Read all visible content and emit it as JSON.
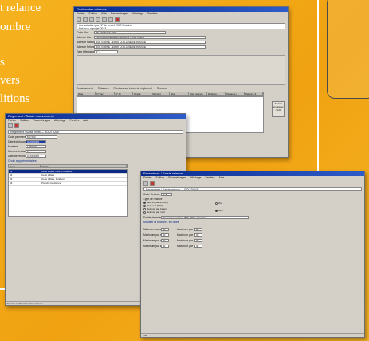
{
  "left_text": [
    "t relance",
    "ombre",
    "s",
    "vers",
    "litions"
  ],
  "win1": {
    "title": "Gestion des relances",
    "menu": [
      "Fichier",
      "Edition",
      "Aide",
      "Paramétrages",
      "Affichage",
      "Fenêtre",
      "Aide"
    ],
    "header_line1": "Consultation par N° de projet 2007 Antoine",
    "header_line2": "Relance n projet 0013",
    "fields": [
      {
        "label": "Code Bloc",
        "value": "R5 · FRANCE 2007"
      },
      {
        "label": "Adresse Livr.",
        "value": "PROGRAMME DE LA MAISON 75000 PARIS"
      },
      {
        "label": "Adresse Factur.",
        "value": "RUE CORNE - 92600 LA PLAINE DE FRANCE"
      },
      {
        "label": "Adresse Relance",
        "value": "RUE CORNE - 92600 LA PLAINE DE FRANCE"
      },
      {
        "label": "Type Affectation",
        "value": "N° 1"
      }
    ],
    "grid_headers": [
      "Date",
      "N° fac",
      "N° bn",
      "Libellé",
      "Montant",
      "Etat",
      "Date relance",
      "Relance 1",
      "Relance 2",
      "Relance 3"
    ],
    "tabs": [
      "Encaissement",
      "Relances",
      "Remises sur traites de règlement",
      "Recouvr."
    ],
    "side_button": "Sortir / Encaisser / Edit"
  },
  "win2": {
    "title": "Règlement / Saisie mouvements",
    "menu": [
      "Fichier",
      "Edition",
      "Paramétrages",
      "Affichage",
      "Fenêtre",
      "Aide"
    ],
    "header": "Réglement / Saisie mvts — BOUTIQUE",
    "fields": [
      {
        "label": "Code paiement",
        "value": "MR 000"
      },
      {
        "label": "Date échéance",
        "value": "01/01/2005"
      },
      {
        "label": "Montant",
        "value": "1 250,00"
      },
      {
        "label": "Nombre à saisir",
        "value": "1"
      },
      {
        "label": "Date de relance",
        "value": "01/01/2005"
      }
    ],
    "section": "Choix supplémentaires",
    "grid_headers": [
      "Code",
      "Libellé"
    ],
    "grid_rows": [
      [
        "01",
        "Cette affaire mise en relance"
      ],
      [
        "02",
        "Cette affaire"
      ],
      [
        "03",
        "Cette affaire, livraison"
      ],
      [
        "04",
        "Prendre la relance"
      ]
    ],
    "status": "Saisie / confirmation des relances"
  },
  "win3": {
    "title": "Paramètres / Saisie relance",
    "menu": [
      "Fichier",
      "Edition",
      "Paramétrages",
      "Affichage",
      "Fenêtre",
      "Aide"
    ],
    "header": "Paramètres / Saisie relance — BOUTIQUE",
    "code_label": "Code Relance",
    "code_value": "RTE",
    "type_label": "Type de relance",
    "options": [
      "Mise en place (MDI)",
      "Proposal (MDI)",
      "Relance par l'agent",
      "Relance par mail"
    ],
    "options_right": [
      "Oui",
      "Non"
    ],
    "entete_label": "Entête de relance",
    "entete_value": "Programme relance RTE 2005 entreprise",
    "modif_label": "Modifier la relance - en ordre",
    "grid_label_left": [
      "Minimum par relance",
      "Maximum par relance",
      "Maximum par mois",
      "Maximum par an"
    ],
    "grid_label_right": [
      "Maximum par relance",
      "Maximum par relance",
      "Maximum par mois",
      "Maximum par an"
    ],
    "grid_values": [
      "00",
      "00",
      "00",
      "00",
      "00",
      "00",
      "00",
      "00"
    ],
    "status": "Prêt"
  }
}
